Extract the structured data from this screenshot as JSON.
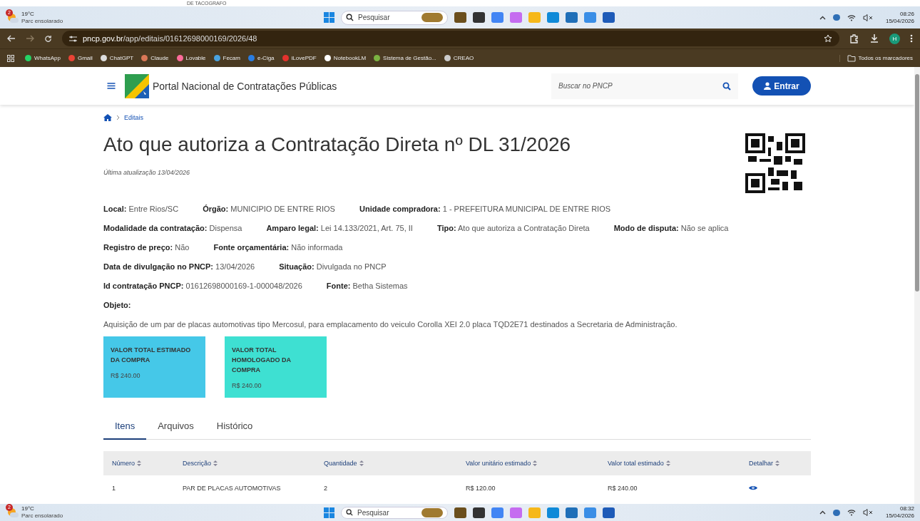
{
  "top_strip": {
    "text": "DE TACOGRAFO"
  },
  "taskbars": [
    {
      "weather_badge": "2",
      "temperature": "19°C",
      "condition": "Parc ensolarado",
      "search_placeholder": "Pesquisar",
      "time": "08:26",
      "date": "15/04/2026"
    },
    {
      "weather_badge": "2",
      "temperature": "19°C",
      "condition": "Parc ensolarado",
      "search_placeholder": "Pesquisar",
      "time": "08:32",
      "date": "15/04/2026"
    }
  ],
  "browser": {
    "url_host": "pncp.gov.br",
    "url_path": "/app/editais/01612698000169/2026/48",
    "profile_initial": "H",
    "bookmarks": [
      {
        "label": "WhatsApp",
        "color": "#25d366"
      },
      {
        "label": "Gmail",
        "color": "#ea4335"
      },
      {
        "label": "ChatGPT",
        "color": "#dddddd"
      },
      {
        "label": "Claude",
        "color": "#d97757"
      },
      {
        "label": "Lovable",
        "color": "#ff6b9a"
      },
      {
        "label": "Fecam",
        "color": "#4aa3df"
      },
      {
        "label": "e-Ciga",
        "color": "#2a7de1"
      },
      {
        "label": "iLovePDF",
        "color": "#e5322d"
      },
      {
        "label": "NotebookLM",
        "color": "#ffffff"
      },
      {
        "label": "Sistema de Gestão...",
        "color": "#7cb342"
      },
      {
        "label": "CREAO",
        "color": "#cccccc"
      }
    ],
    "all_bookmarks": "Todos os marcadores"
  },
  "site": {
    "title": "Portal Nacional de Contratações Públicas",
    "search_placeholder": "Buscar no PNCP",
    "login": "Entrar"
  },
  "breadcrumb": [
    "Editais"
  ],
  "heading": "Ato que autoriza a Contratação Direta nº DL 31/2026",
  "updated": "Última atualização 13/04/2026",
  "info_rows": [
    [
      "**Local:** Entre Rios/SC",
      "**Órgão:** MUNICIPIO DE ENTRE RIOS",
      "**Unidade compradora:** 1 - PREFEITURA MUNICIPAL DE ENTRE RIOS"
    ],
    [
      "**Modalidade da contratação:** Dispensa",
      "**Amparo legal:** Lei 14.133/2021, Art. 75, II",
      "**Tipo:** Ato que autoriza a Contratação Direta",
      "**Modo de disputa:** Não se aplica"
    ],
    [
      "**Registro de preço:** Não",
      "**Fonte orçamentária:** Não informada"
    ],
    [
      "**Data de divulgação no PNCP:** 13/04/2026",
      "**Situação:** Divulgada no PNCP"
    ],
    [
      "**Id contratação PNCP:** 01612698000169-1-000048/2026",
      "**Fonte:** Betha Sistemas"
    ]
  ],
  "objeto": {
    "label": "Objeto:",
    "text": "Aquisição de um par de placas automotivas tipo Mercosul, para emplacamento do veiculo Corolla XEI 2.0 placa TQD2E71 destinados a Secretaria de Administração."
  },
  "value_cards": [
    {
      "title": "VALOR TOTAL ESTIMADO DA COMPRA",
      "value": "R$ 240.00",
      "color": "#45c8e8"
    },
    {
      "title": "VALOR TOTAL HOMOLOGADO DA COMPRA",
      "value": "R$ 240.00",
      "color": "#3ee0d2"
    }
  ],
  "tabs": [
    {
      "label": "Itens",
      "selected": true
    },
    {
      "label": "Arquivos",
      "selected": false
    },
    {
      "label": "Histórico",
      "selected": false
    }
  ],
  "table": {
    "columns": [
      "Número",
      "Descrição",
      "Quantidade",
      "Valor unitário estimado",
      "Valor total estimado",
      "Detalhar"
    ],
    "rows": [
      [
        "1",
        "PAR DE PLACAS AUTOMOTIVAS",
        "2",
        "R$ 120.00",
        "R$ 240.00"
      ]
    ]
  }
}
